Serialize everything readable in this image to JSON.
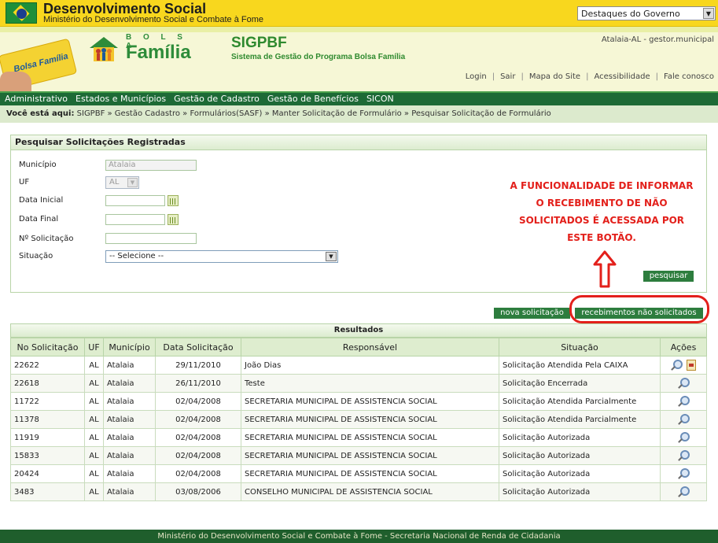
{
  "gov_bar": {
    "title": "Desenvolvimento Social",
    "subtitle": "Ministério do Desenvolvimento Social e Combate à Fome",
    "dropdown": "Destaques do Governo"
  },
  "banner": {
    "card_text": "Bolsa Família",
    "logo_top": "B O L S A",
    "logo_bottom": "Família",
    "system_title": "SIGPBF",
    "system_subtitle": "Sistema de Gestão do Programa Bolsa Família",
    "user": "Atalaia-AL - gestor.municipal",
    "links": [
      "Login",
      "Sair",
      "Mapa do Site",
      "Acessibilidade",
      "Fale conosco"
    ]
  },
  "nav": [
    "Administrativo",
    "Estados e Municípios",
    "Gestão de Cadastro",
    "Gestão de Benefícios",
    "SICON"
  ],
  "breadcrumb": {
    "prefix": "Você está aqui:",
    "path": "SIGPBF » Gestão Cadastro » Formulários(SASF) » Manter Solicitação de Formulário » Pesquisar Solicitação de Formulário"
  },
  "search": {
    "heading": "Pesquisar Solicitações Registradas",
    "municipio_label": "Município",
    "municipio_value": "Atalaia",
    "uf_label": "UF",
    "uf_value": "AL",
    "data_inicial_label": "Data Inicial",
    "data_final_label": "Data Final",
    "numero_label": "Nº Solicitação",
    "situacao_label": "Situação",
    "situacao_value": "-- Selecione --",
    "search_button": "pesquisar"
  },
  "annotation": "A FUNCIONALIDADE DE INFORMAR O RECEBIMENTO DE NÃO SOLICITADOS É ACESSADA POR ESTE BOTÃO.",
  "actions": {
    "new_button": "nova solicitação",
    "unsolicited_button": "recebimentos não solicitados"
  },
  "results": {
    "title": "Resultados",
    "columns": [
      "No Solicitação",
      "UF",
      "Município",
      "Data Solicitação",
      "Responsável",
      "Situação",
      "Ações"
    ],
    "rows": [
      {
        "numero": "22622",
        "uf": "AL",
        "municipio": "Atalaia",
        "data": "29/11/2010",
        "responsavel": "João Dias",
        "situacao": "Solicitação Atendida Pela CAIXA",
        "extra": true
      },
      {
        "numero": "22618",
        "uf": "AL",
        "municipio": "Atalaia",
        "data": "26/11/2010",
        "responsavel": "Teste",
        "situacao": "Solicitação Encerrada",
        "extra": false
      },
      {
        "numero": "11722",
        "uf": "AL",
        "municipio": "Atalaia",
        "data": "02/04/2008",
        "responsavel": "SECRETARIA MUNICIPAL DE ASSISTENCIA SOCIAL",
        "situacao": "Solicitação Atendida Parcialmente",
        "extra": false
      },
      {
        "numero": "11378",
        "uf": "AL",
        "municipio": "Atalaia",
        "data": "02/04/2008",
        "responsavel": "SECRETARIA MUNICIPAL DE ASSISTENCIA SOCIAL",
        "situacao": "Solicitação Atendida Parcialmente",
        "extra": false
      },
      {
        "numero": "11919",
        "uf": "AL",
        "municipio": "Atalaia",
        "data": "02/04/2008",
        "responsavel": "SECRETARIA MUNICIPAL DE ASSISTENCIA SOCIAL",
        "situacao": "Solicitação Autorizada",
        "extra": false
      },
      {
        "numero": "15833",
        "uf": "AL",
        "municipio": "Atalaia",
        "data": "02/04/2008",
        "responsavel": "SECRETARIA MUNICIPAL DE ASSISTENCIA SOCIAL",
        "situacao": "Solicitação Autorizada",
        "extra": false
      },
      {
        "numero": "20424",
        "uf": "AL",
        "municipio": "Atalaia",
        "data": "02/04/2008",
        "responsavel": "SECRETARIA MUNICIPAL DE ASSISTENCIA SOCIAL",
        "situacao": "Solicitação Autorizada",
        "extra": false
      },
      {
        "numero": "3483",
        "uf": "AL",
        "municipio": "Atalaia",
        "data": "03/08/2006",
        "responsavel": "CONSELHO MUNICIPAL DE ASSISTENCIA SOCIAL",
        "situacao": "Solicitação Autorizada",
        "extra": false
      }
    ]
  },
  "footer": "Ministério do Desenvolvimento Social e Combate à Fome - Secretaria Nacional de Renda de Cidadania",
  "colors": {
    "gov_yellow": "#f8d71e",
    "nav_green": "#1d6a36",
    "button_green": "#2d7d3e",
    "annotation_red": "#e3201b"
  }
}
